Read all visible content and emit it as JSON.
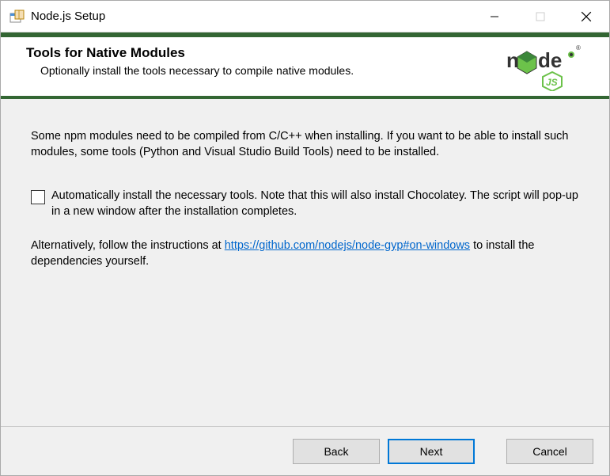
{
  "titlebar": {
    "title": "Node.js Setup"
  },
  "header": {
    "title": "Tools for Native Modules",
    "subtitle": "Optionally install the tools necessary to compile native modules."
  },
  "content": {
    "intro": "Some npm modules need to be compiled from C/C++ when installing. If you want to be able to install such modules, some tools (Python and Visual Studio Build Tools) need to be installed.",
    "checkbox_label": "Automatically install the necessary tools. Note that this will also install Chocolatey. The script will pop-up in a new window after the installation completes.",
    "alt_pre": "Alternatively, follow the instructions at ",
    "alt_link": "https://github.com/nodejs/node-gyp#on-windows",
    "alt_post": " to install the dependencies yourself."
  },
  "buttons": {
    "back": "Back",
    "next": "Next",
    "cancel": "Cancel"
  }
}
